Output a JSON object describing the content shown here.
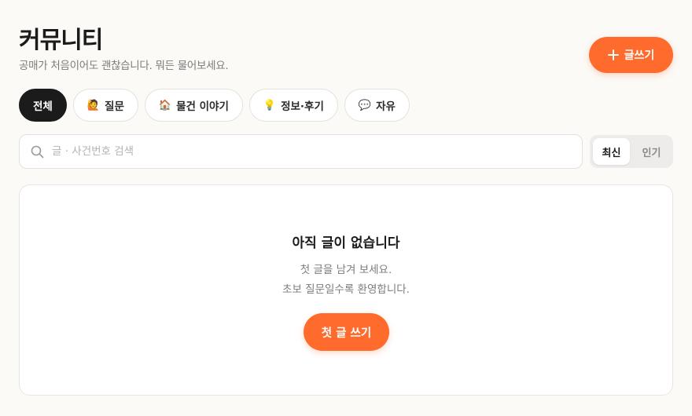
{
  "header": {
    "title": "커뮤니티",
    "subtitle": "공매가 처음이어도 괜찮습니다. 뭐든 물어보세요.",
    "write_label": "글쓰기"
  },
  "tabs": [
    {
      "icon": "",
      "label": "전체",
      "active": true
    },
    {
      "icon": "🙋",
      "label": "질문",
      "active": false
    },
    {
      "icon": "🏠",
      "label": "물건 이야기",
      "active": false
    },
    {
      "icon": "💡",
      "label": "정보·후기",
      "active": false
    },
    {
      "icon": "💬",
      "label": "자유",
      "active": false
    }
  ],
  "search": {
    "placeholder": "글 · 사건번호 검색",
    "value": ""
  },
  "sort": {
    "options": [
      "최신",
      "인기"
    ],
    "selected": "최신"
  },
  "empty_state": {
    "title": "아직 글이 없습니다",
    "line1": "첫 글을 남겨 보세요.",
    "line2": "초보 질문일수록 환영합니다.",
    "button_label": "첫 글 쓰기"
  },
  "colors": {
    "accent": "#ff6b2c",
    "background": "#fbfaf6",
    "active_tab": "#1b1b1b"
  }
}
